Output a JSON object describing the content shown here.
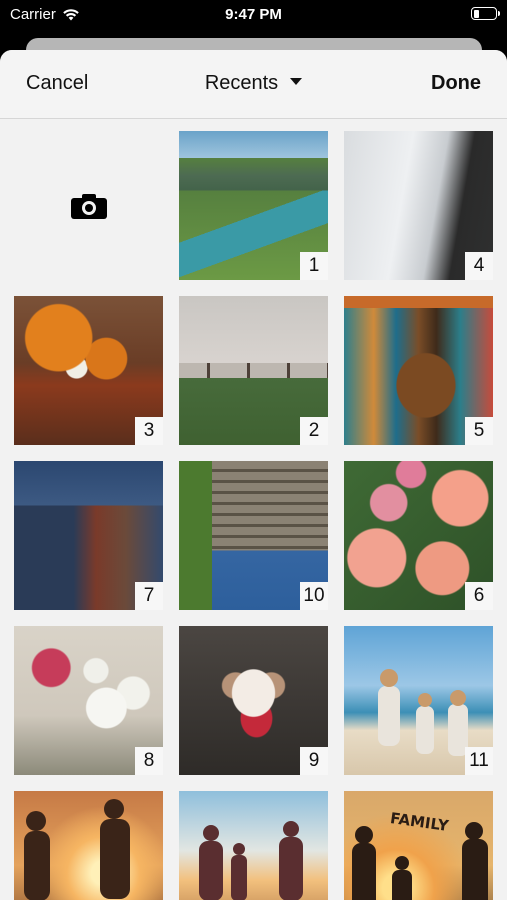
{
  "status_bar": {
    "carrier": "Carrier",
    "time": "9:47 PM",
    "battery_level": 0.25
  },
  "nav": {
    "cancel_label": "Cancel",
    "title": "Recents",
    "done_label": "Done"
  },
  "grid": {
    "camera_icon": "camera-icon",
    "photos": [
      {
        "badge": "1",
        "subject": "lake"
      },
      {
        "badge": "4",
        "subject": "snowpath"
      },
      {
        "badge": "3",
        "subject": "pumpkins"
      },
      {
        "badge": "2",
        "subject": "trees"
      },
      {
        "badge": "5",
        "subject": "temple"
      },
      {
        "badge": "7",
        "subject": "bikes"
      },
      {
        "badge": "10",
        "subject": "building"
      },
      {
        "badge": "6",
        "subject": "roses"
      },
      {
        "badge": "8",
        "subject": "lilies"
      },
      {
        "badge": "9",
        "subject": "dog"
      },
      {
        "badge": "11",
        "subject": "beach"
      },
      {
        "badge": "",
        "subject": "sunset1"
      },
      {
        "badge": "",
        "subject": "sunset2"
      },
      {
        "badge": "",
        "subject": "family",
        "overlay_text": "FAMILY"
      }
    ]
  }
}
